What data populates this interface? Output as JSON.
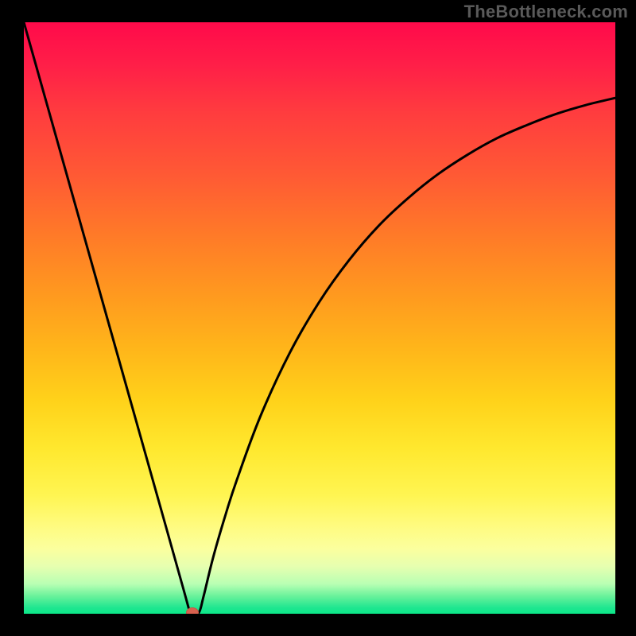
{
  "branding": {
    "watermark": "TheBottleneck.com"
  },
  "colors": {
    "page_bg": "#000000",
    "curve_stroke": "#000000",
    "marker_fill": "#d8614f",
    "gradient_stops": [
      {
        "pct": 0,
        "hex": "#ff0a4a"
      },
      {
        "pct": 15,
        "hex": "#ff3b3f"
      },
      {
        "pct": 36,
        "hex": "#ff7a28"
      },
      {
        "pct": 55,
        "hex": "#ffb51a"
      },
      {
        "pct": 72,
        "hex": "#ffe82e"
      },
      {
        "pct": 89,
        "hex": "#fbff9e"
      },
      {
        "pct": 100,
        "hex": "#0be889"
      }
    ]
  },
  "chart_data": {
    "type": "line",
    "title": "",
    "xlabel": "",
    "ylabel": "",
    "xlim": [
      0,
      100
    ],
    "ylim": [
      0,
      100
    ],
    "grid": false,
    "legend": null,
    "annotations": [],
    "notch": {
      "x": 28.5,
      "y": 0
    },
    "series": [
      {
        "name": "bottleneck-curve",
        "x": [
          0,
          4,
          8,
          12,
          16,
          20,
          24,
          27,
          28.1,
          28.5,
          29.6,
          30.4,
          32,
          34,
          36,
          40,
          45,
          50,
          55,
          60,
          65,
          70,
          75,
          80,
          85,
          90,
          95,
          100
        ],
        "y": [
          100,
          85.8,
          71.6,
          57.4,
          43.2,
          29.0,
          14.8,
          4.1,
          0.2,
          0.0,
          0.2,
          3.0,
          9.5,
          16.4,
          22.6,
          33.4,
          44.2,
          52.8,
          59.8,
          65.6,
          70.3,
          74.3,
          77.6,
          80.4,
          82.6,
          84.5,
          86.0,
          87.2
        ]
      }
    ],
    "marker": {
      "x": 28.5,
      "y": 0,
      "color": "#d8614f"
    }
  }
}
